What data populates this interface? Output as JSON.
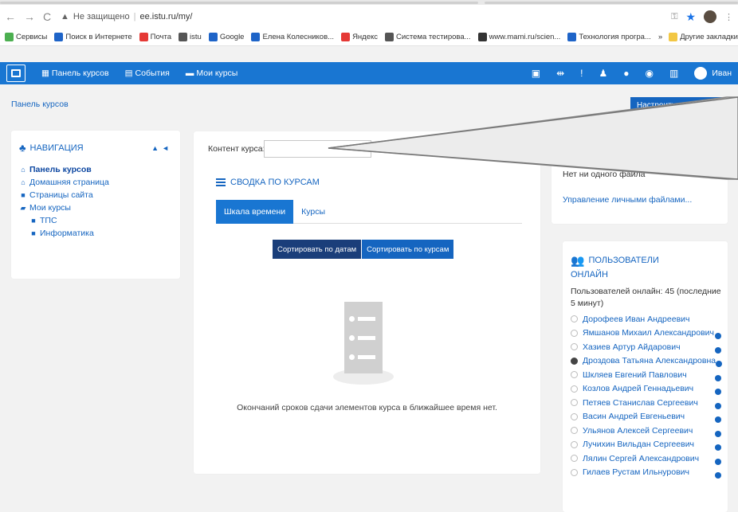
{
  "browser": {
    "insecure_label": "Не защищено",
    "url": "ee.istu.ru/my/",
    "bookmarks": [
      {
        "label": "Сервисы",
        "color": "#4caf50"
      },
      {
        "label": "Поиск в Интернете",
        "color": "#1e64c8"
      },
      {
        "label": "Почта",
        "color": "#e53935"
      },
      {
        "label": "istu",
        "color": "#555555"
      },
      {
        "label": "Google",
        "color": "#1e64c8"
      },
      {
        "label": "Елена Колесников...",
        "color": "#1e64c8"
      },
      {
        "label": "Яндекс",
        "color": "#e53935"
      },
      {
        "label": "Система тестирова...",
        "color": "#555555"
      },
      {
        "label": "www.mami.ru/scien...",
        "color": "#333333"
      },
      {
        "label": "Технология програ...",
        "color": "#1e64c8"
      }
    ],
    "other_bookmarks": "Другие закладки"
  },
  "navbar": {
    "dashboard": "Панель курсов",
    "events": "События",
    "my_courses": "Мои курсы",
    "user_name": "Иван"
  },
  "page": {
    "breadcrumb": "Панель курсов",
    "customise_button": "Настроить эту страницу"
  },
  "navigation": {
    "title": "НАВИГАЦИЯ",
    "items": [
      {
        "label": "Панель курсов",
        "icon": "home-icon"
      },
      {
        "label": "Домашняя страница",
        "icon": "home-icon"
      },
      {
        "label": "Страницы сайта",
        "icon": "folder-icon"
      },
      {
        "label": "Мои курсы",
        "icon": "folder-open-icon"
      },
      {
        "label": "ТПС",
        "icon": "folder-icon"
      },
      {
        "label": "Информатика",
        "icon": "folder-icon"
      }
    ]
  },
  "main": {
    "content_label": "Контент курса:",
    "summary_title": "СВОДКА ПО КУРСАМ",
    "tabs": [
      "Шкала времени",
      "Курсы"
    ],
    "sort_by_dates": "Сортировать по датам",
    "sort_by_courses": "Сортировать по курсам",
    "empty_text": "Окончаний сроков сдачи элементов курса в ближайшее время нет."
  },
  "files": {
    "no_files": "Нет ни одного файла",
    "manage_link": "Управление личными файлами..."
  },
  "online_users": {
    "title": "ПОЛЬЗОВАТЕЛИ",
    "title2": "ОНЛАЙН",
    "info": "Пользователей онлайн: 45 (последние 5 минут)",
    "users": [
      "Дорофеев Иван Андреевич",
      "Ямшанов Михаил Александрович",
      "Хазиев Артур Айдарович",
      "Дроздова Татьяна Александровна",
      "Шкляев Евгений Павлович",
      "Козлов Андрей Геннадьевич",
      "Петяев Станислав Сергеевич",
      "Васин Андрей Евгеньевич",
      "Ульянов Алексей Сергеевич",
      "Лучихин Вильдан Сергеевич",
      "Лялин Сергей Александрович",
      "Гилаев Рустам Ильнурович"
    ]
  }
}
